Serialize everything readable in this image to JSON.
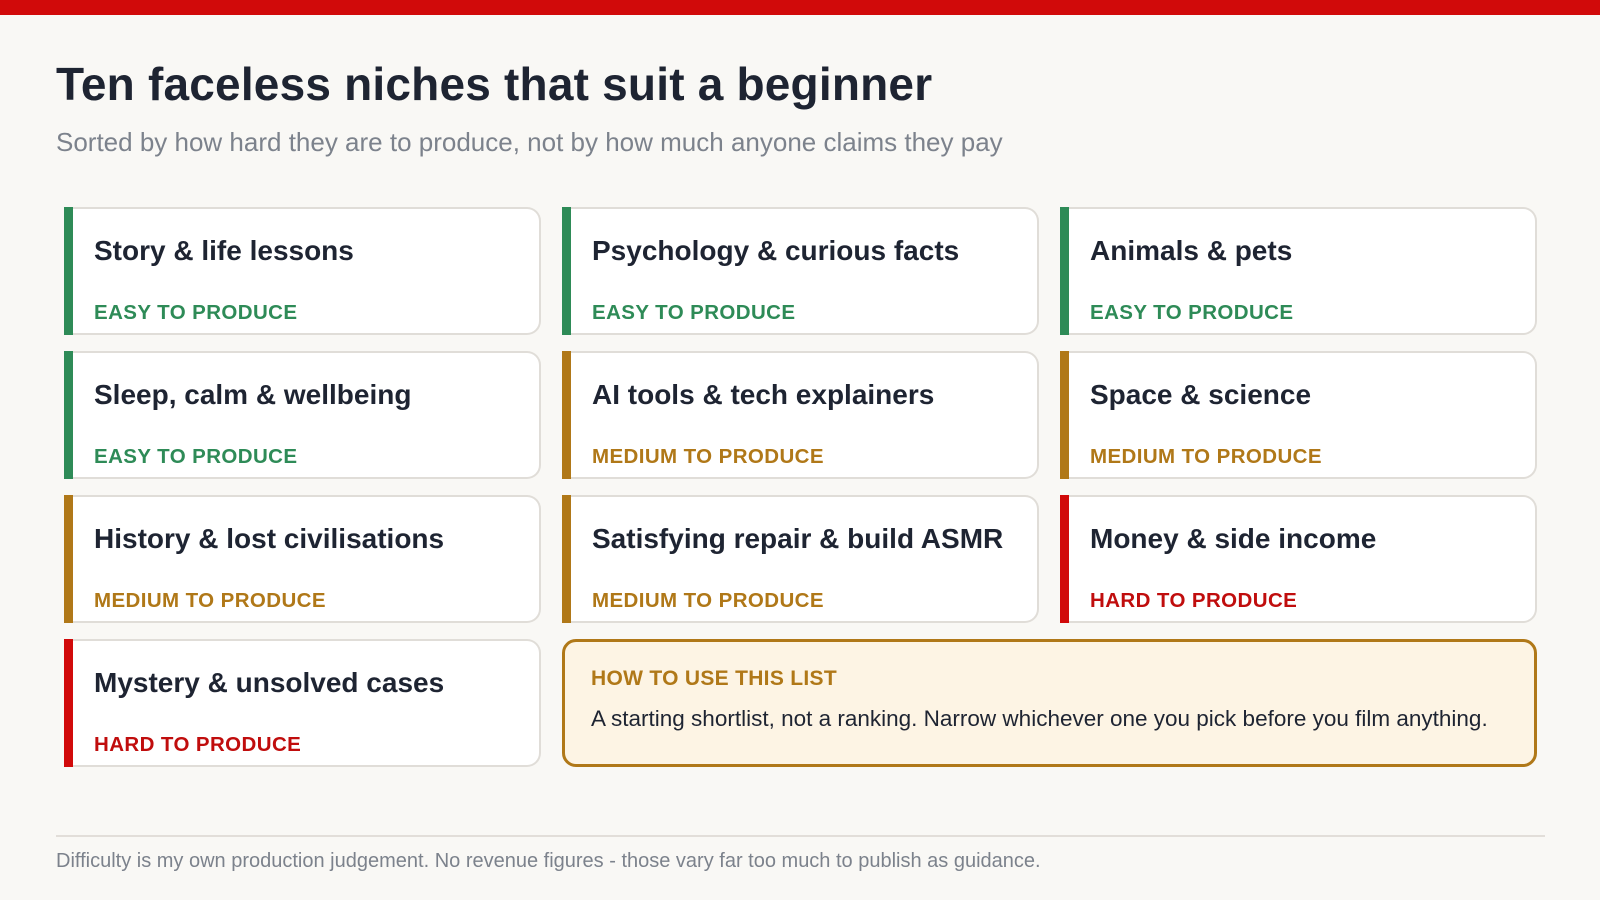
{
  "header": {
    "title": "Ten faceless niches that suit a beginner",
    "subtitle": "Sorted by how hard they are to produce, not by how much anyone claims they pay"
  },
  "colors": {
    "accent_red": "#d10a0a",
    "easy": "#2e8b57",
    "medium": "#b07818",
    "hard": "#c00d0d"
  },
  "niches": [
    {
      "name": "Story & life lessons",
      "difficulty": "EASY TO PRODUCE"
    },
    {
      "name": "Psychology & curious facts",
      "difficulty": "EASY TO PRODUCE"
    },
    {
      "name": "Animals & pets",
      "difficulty": "EASY TO PRODUCE"
    },
    {
      "name": "Sleep, calm & wellbeing",
      "difficulty": "EASY TO PRODUCE"
    },
    {
      "name": "AI tools & tech explainers",
      "difficulty": "MEDIUM TO PRODUCE"
    },
    {
      "name": "Space & science",
      "difficulty": "MEDIUM TO PRODUCE"
    },
    {
      "name": "History & lost civilisations",
      "difficulty": "MEDIUM TO PRODUCE"
    },
    {
      "name": "Satisfying repair & build ASMR",
      "difficulty": "MEDIUM TO PRODUCE"
    },
    {
      "name": "Money & side income",
      "difficulty": "HARD TO PRODUCE"
    },
    {
      "name": "Mystery & unsolved cases",
      "difficulty": "HARD TO PRODUCE"
    }
  ],
  "note": {
    "heading": "HOW TO USE THIS LIST",
    "body": "A starting shortlist, not a ranking. Narrow whichever one you pick before you film anything."
  },
  "footer": {
    "text": "Difficulty is my own production judgement. No revenue figures - those vary far too much to publish as guidance."
  }
}
